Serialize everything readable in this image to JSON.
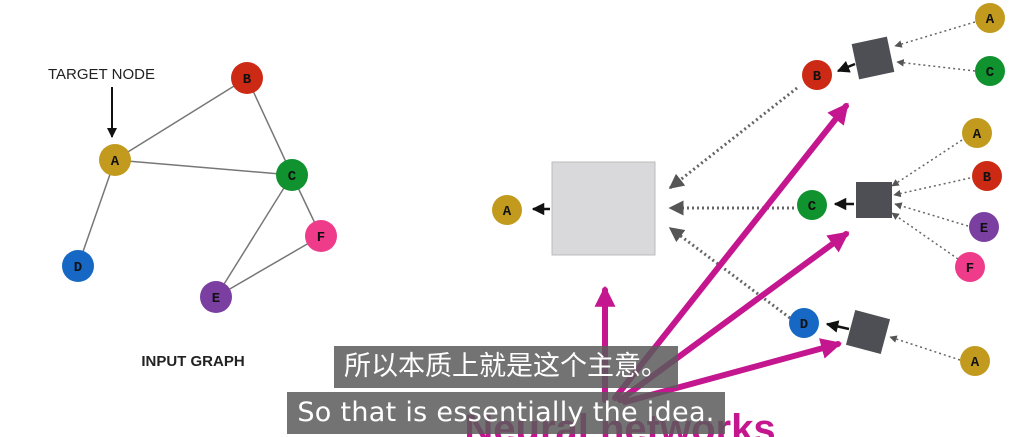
{
  "left_panel": {
    "target_label": "TARGET NODE",
    "graph_label": "INPUT GRAPH",
    "nodes": [
      {
        "id": "A",
        "color": "#c29a1e"
      },
      {
        "id": "B",
        "color": "#cc2a14"
      },
      {
        "id": "C",
        "color": "#10922f"
      },
      {
        "id": "D",
        "color": "#1668c4"
      },
      {
        "id": "E",
        "color": "#7a3fa0"
      },
      {
        "id": "F",
        "color": "#ee3c8a"
      }
    ],
    "edges": [
      [
        "A",
        "B"
      ],
      [
        "A",
        "C"
      ],
      [
        "B",
        "C"
      ],
      [
        "A",
        "D"
      ],
      [
        "C",
        "E"
      ],
      [
        "C",
        "F"
      ],
      [
        "E",
        "F"
      ]
    ]
  },
  "right_panel": {
    "target": {
      "id": "A",
      "color": "#c29a1e"
    },
    "level1": [
      {
        "id": "B",
        "color": "#cc2a14"
      },
      {
        "id": "C",
        "color": "#10922f"
      },
      {
        "id": "D",
        "color": "#1668c4"
      }
    ],
    "level2": [
      {
        "id": "A",
        "color": "#c29a1e"
      },
      {
        "id": "C",
        "color": "#10922f"
      },
      {
        "id": "A",
        "color": "#c29a1e"
      },
      {
        "id": "B",
        "color": "#cc2a14"
      },
      {
        "id": "E",
        "color": "#7a3fa0"
      },
      {
        "id": "F",
        "color": "#ee3c8a"
      },
      {
        "id": "A",
        "color": "#c29a1e"
      }
    ],
    "background_text": "Neural networks",
    "arrow_color": "#c4168f"
  },
  "subtitles": {
    "zh": "所以本质上就是这个主意。",
    "en": "So that is essentially the idea."
  }
}
